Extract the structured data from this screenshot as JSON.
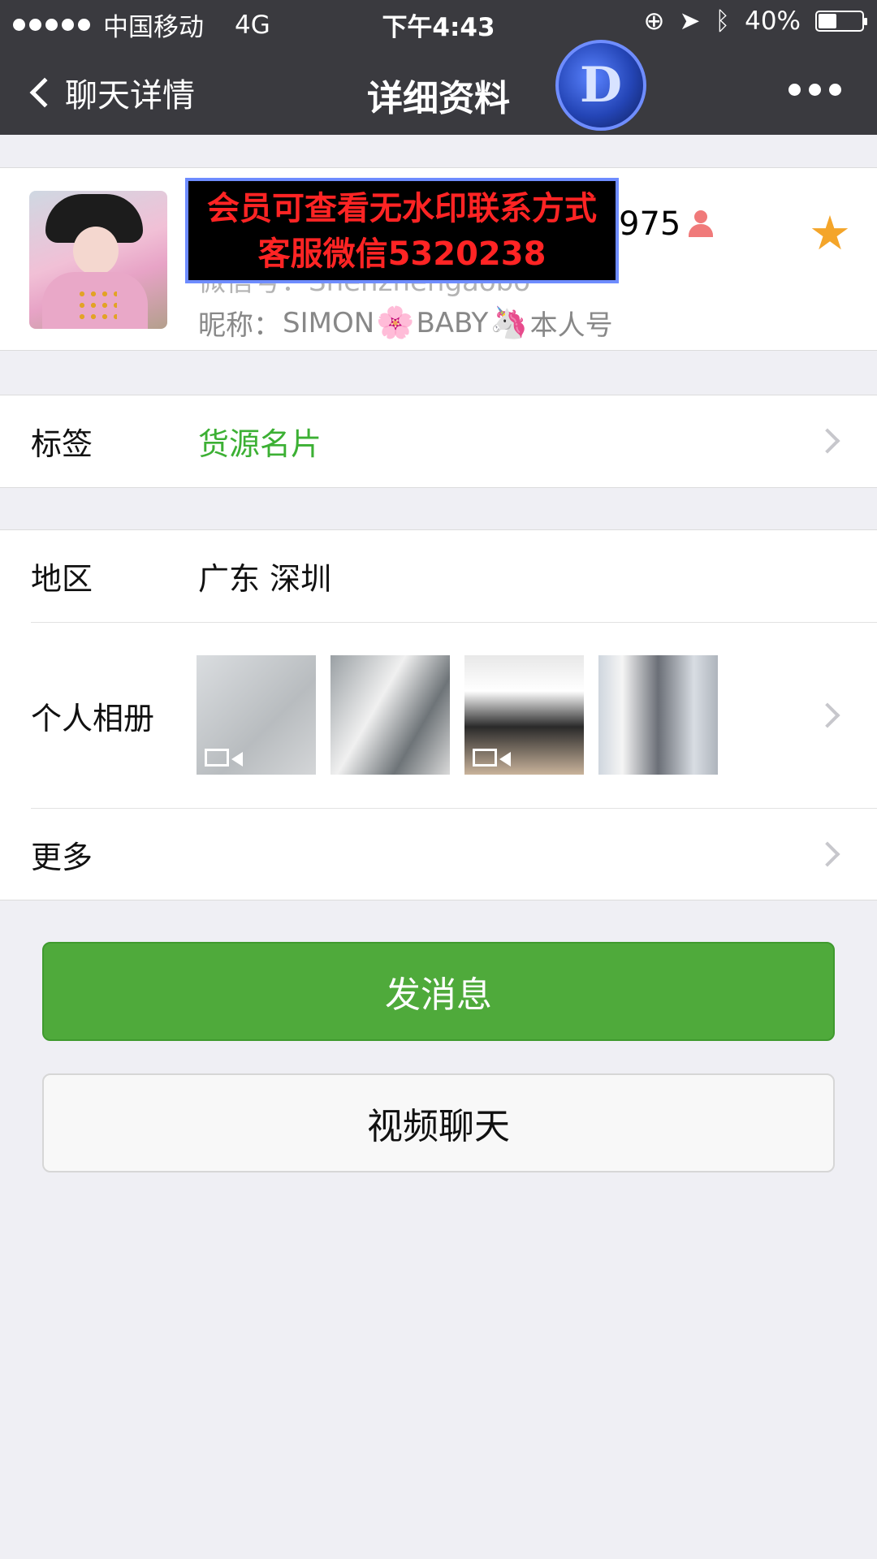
{
  "status_bar": {
    "carrier": "中国移动",
    "network": "4G",
    "time": "下午4:43",
    "battery": "40%"
  },
  "nav": {
    "back_label": "聊天详情",
    "title": "详细资料",
    "logo_glyph": "D"
  },
  "profile": {
    "watermark_line1": "会员可查看无水印联系方式",
    "watermark_line2": "客服微信5320238",
    "wxid_suffix": "975",
    "wxid_line": "微信号：Shenzhengaobo",
    "nickname_label": "昵称：",
    "nickname_part1": "SIMON",
    "nickname_emoji1": "🌸",
    "nickname_part2": "BABY",
    "nickname_emoji2": "🦄",
    "nickname_part3": "本人号",
    "starred": true
  },
  "tag_row": {
    "label": "标签",
    "value": "货源名片",
    "value_color": "#3cb034"
  },
  "details": {
    "region_label": "地区",
    "region_value": "广东 深圳",
    "album_label": "个人相册",
    "album_photos": [
      {
        "has_video": true
      },
      {
        "has_video": false
      },
      {
        "has_video": true
      },
      {
        "has_video": false
      }
    ],
    "more_label": "更多"
  },
  "buttons": {
    "send_message": "发消息",
    "video_call": "视频聊天"
  },
  "colors": {
    "nav_bg": "#3a3a3f",
    "primary_green": "#4faa3b",
    "star": "#f4a52a"
  }
}
